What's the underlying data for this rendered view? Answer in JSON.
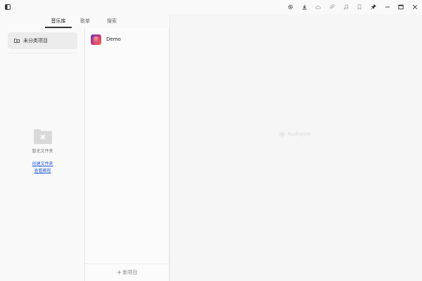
{
  "tabs": [
    {
      "label": "音乐库",
      "active": true
    },
    {
      "label": "歌单",
      "active": false
    },
    {
      "label": "搜索",
      "active": false
    }
  ],
  "window_icons": [
    "settings-icon",
    "download-icon",
    "cloud-icon",
    "attachment-icon",
    "music-note-icon",
    "bookmark-icon",
    "pin-icon",
    "minimize-icon",
    "maximize-icon",
    "close-icon"
  ],
  "left_panel": {
    "category_label": "未分类项目",
    "empty_text": "暂无文件夹",
    "link_create": "创建文件夹",
    "link_tutorial": "查看教程"
  },
  "mid_panel": {
    "project_name": "Demo",
    "new_project_label": "新项目"
  },
  "right_panel": {
    "watermark": "AudioJam"
  },
  "colors": {
    "link": "#2a5fd8",
    "accent": "#333333"
  }
}
